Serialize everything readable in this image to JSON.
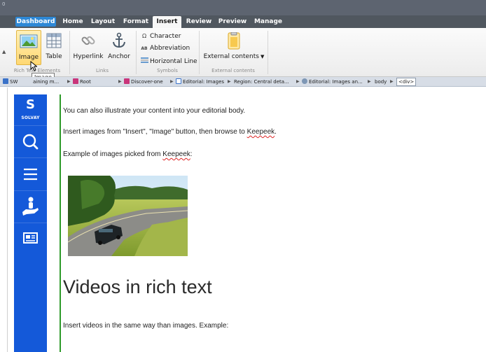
{
  "window": {
    "title": "0"
  },
  "tabs": [
    {
      "label": "Dashboard"
    },
    {
      "label": "Home"
    },
    {
      "label": "Layout"
    },
    {
      "label": "Format"
    },
    {
      "label": "Insert"
    },
    {
      "label": "Review"
    },
    {
      "label": "Preview"
    },
    {
      "label": "Manage"
    }
  ],
  "active_tab": "Insert",
  "ribbon": {
    "rich_elements": {
      "group_label": "Rich Text Elements",
      "image_label": "Image",
      "table_label": "Table"
    },
    "links": {
      "group_label": "Links",
      "hyperlink_label": "Hyperlink",
      "anchor_label": "Anchor"
    },
    "symbols": {
      "group_label": "Symbols",
      "character_label": "Character",
      "abbreviation_label": "Abbreviation",
      "horizontal_line_label": "Horizontal Line"
    },
    "external": {
      "group_label": "External contents",
      "button_label": "External contents"
    }
  },
  "tooltip": {
    "text": "Image"
  },
  "breadcrumb": [
    {
      "label": "SW",
      "icon": "channel-icon"
    },
    {
      "label": "aining m...",
      "icon": ""
    },
    {
      "label": "Root",
      "icon": "folder-icon"
    },
    {
      "label": "Discover-one",
      "icon": "folder-icon"
    },
    {
      "label": "Editorial: Images",
      "icon": "page-icon"
    },
    {
      "label": "Region: Central deta...",
      "icon": ""
    },
    {
      "label": "Editorial: Images an...",
      "icon": "component-icon"
    },
    {
      "label": "body",
      "icon": ""
    },
    {
      "label": "<div>",
      "icon": ""
    }
  ],
  "sidebar": {
    "logo_letter": "S",
    "logo_text": "SOLVAY",
    "items": [
      {
        "icon": "search-icon"
      },
      {
        "icon": "menu-icon"
      },
      {
        "icon": "user-hand-icon"
      },
      {
        "icon": "newspaper-icon"
      }
    ]
  },
  "content": {
    "p1": "You can also illustrate your content into your editorial body.",
    "p2_before": "Insert images from \"Insert\", \"Image\" button, then browse to ",
    "p2_link": "Keepeek",
    "p2_after": ".",
    "p3_before": "Example of images picked from ",
    "p3_link": "Keepeek",
    "p3_after": ":",
    "heading": "Videos in rich text",
    "p4": "Insert videos in the same way than images. Example:"
  },
  "colors": {
    "tab_bar": "#50575f",
    "dashboard_tab": "#2e88d6",
    "sidebar_blue": "#1459d9",
    "edit_border_green": "#2e9a2a"
  }
}
